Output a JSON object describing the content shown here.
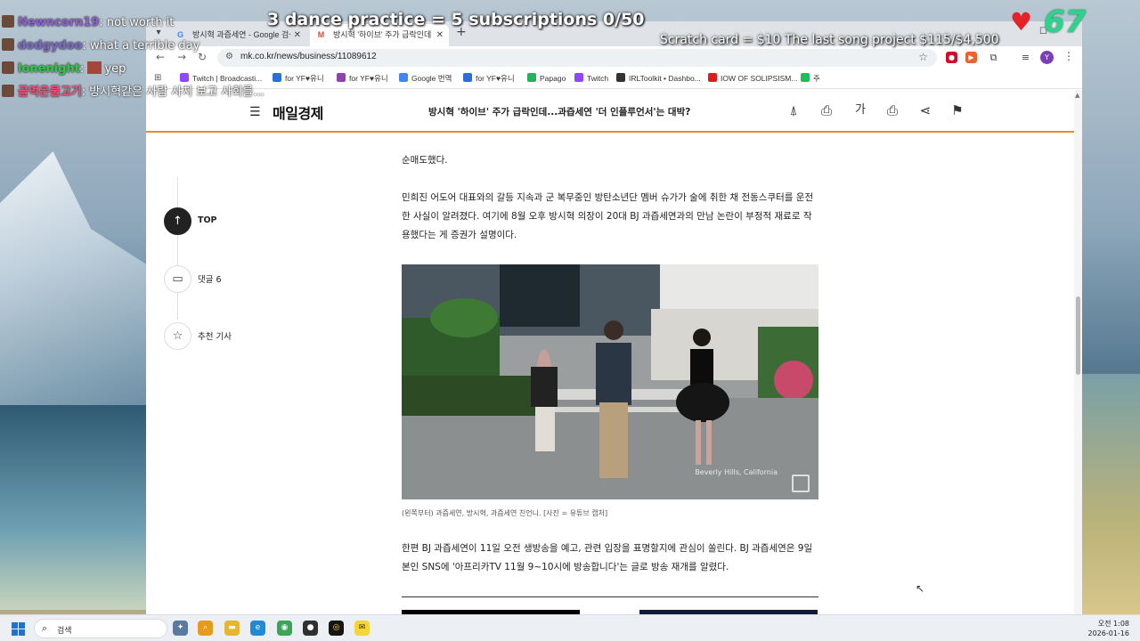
{
  "browser": {
    "tabs": [
      {
        "label": "방시혁 과즙세연 - Google 검색",
        "favicon": "G",
        "active": false
      },
      {
        "label": "방시혁 '하이브' 주가 급락인데",
        "favicon": "M",
        "active": true
      }
    ],
    "new_tab": "+",
    "url": "mk.co.kr/news/business/11089612",
    "bookmarks": [
      {
        "label": "Twitch | Broadcasti...",
        "color": "#9146ff"
      },
      {
        "label": "for YF♥유니",
        "color": "#2b6fd6"
      },
      {
        "label": "for YF♥유니",
        "color": "#8e44ad"
      },
      {
        "label": "Google 번역",
        "color": "#4285f4"
      },
      {
        "label": "for YF♥유니",
        "color": "#2b6fd6"
      },
      {
        "label": "Papago",
        "color": "#22b45a"
      },
      {
        "label": "Twitch",
        "color": "#9146ff"
      },
      {
        "label": "IRLToolkit • Dashbo...",
        "color": "#333333"
      },
      {
        "label": "IOW OF SOLIPSISM...",
        "color": "#e01b1b"
      },
      {
        "label": "주",
        "color": "#19c05a"
      }
    ],
    "profile_initial": "Y"
  },
  "site": {
    "logo": "매일경제",
    "header_title": "방시혁 '하이브' 주가 급락인데...과즙세연 '더 인플루언서'는 대박?",
    "accent": "#f08a24",
    "font_size_label": "가"
  },
  "rail": {
    "top": "TOP",
    "comments": "댓글 6",
    "recommended": "추천 기사"
  },
  "article": {
    "p0": "순매도했다.",
    "p1": "민희진 어도어 대표와의 갈등 지속과 군 복무중인 방탄소년단 멤버 슈가가 술에 취한 채 전동스쿠터를 운전한 사실이 알려졌다. 여기에 8월 오후 방시혁 의장이 20대 BJ 과즙세연과의 만남 논란이 부정적 재료로 작용했다는 게 증권가 설명이다.",
    "photo_overlay": "Beverly Hills, California",
    "caption": "(왼쪽부터) 과즙세연, 방시혁, 과즙세연 친언니. [사진 = 유튜브 캡처]",
    "p2": "한편 BJ 과즙세연이 11일 오전 생방송을 예고, 관련 입장을 표명할지에 관심이 쏠린다. BJ 과즙세연은 9일 본인 SNS에 '아프리카TV 11월 9~10시에 방송합니다'는 글로 방송 재개를 알렸다."
  },
  "taskbar": {
    "search_label": "검색",
    "time": "오전 1:08",
    "date": "2026-01-16"
  },
  "overlay": {
    "goal1": "3 dance practice = 5 subscriptions 0/50",
    "goal2": "Scratch card = $10 The last song project $115/$4,500",
    "like_count": "67",
    "chat": [
      {
        "user": "Newncorn19",
        "msg": "not worth it",
        "color": "#8e5fd0"
      },
      {
        "user": "dodgydoo",
        "msg": "what a terrible day",
        "color": "#7b68c9"
      },
      {
        "user": "lonenight",
        "msg": "yep",
        "color": "#2ecc40"
      },
      {
        "user": "골먹은물고기",
        "msg": "방시혁같은 사람 사치 보고 사회를...",
        "color": "#ff4d7a"
      }
    ]
  }
}
